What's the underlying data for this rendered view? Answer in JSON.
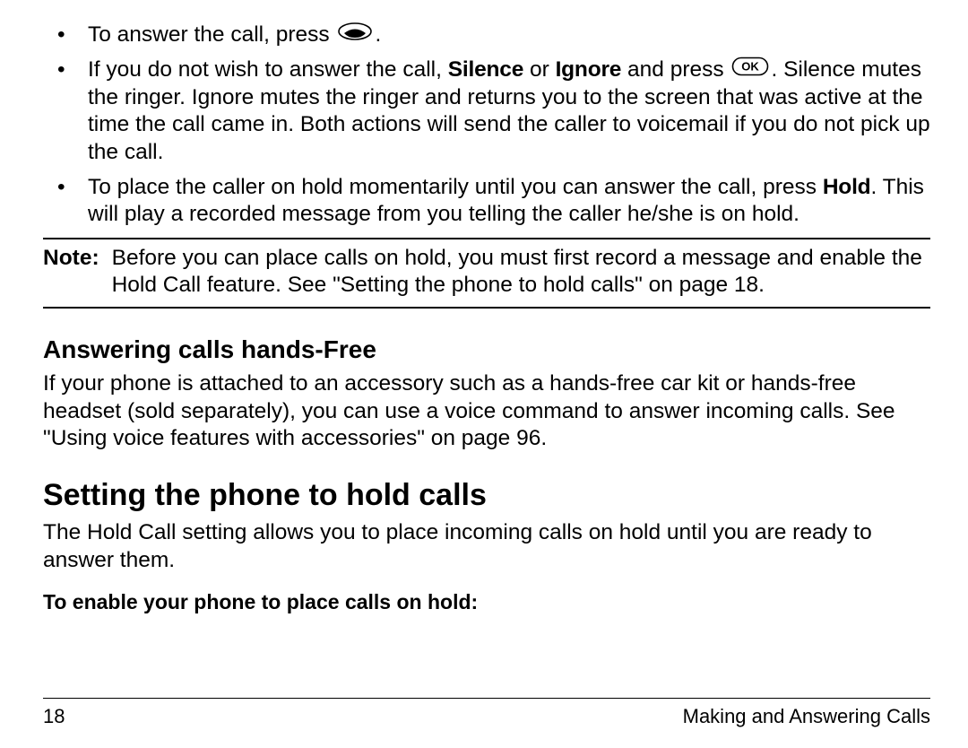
{
  "bullets": {
    "b1_pre": "To answer the call, press ",
    "b1_post": ".",
    "b2_pre": "If you do not wish to answer the call, ",
    "b2_silence": "Silence",
    "b2_or": " or ",
    "b2_ignore": "Ignore",
    "b2_mid": " and press ",
    "b2_post": ". Silence mutes the ringer. Ignore mutes the ringer and returns you to the screen that was active at the time the call came in. Both actions will send the caller to voicemail if you do not pick up the call.",
    "b3_pre": "To place the caller on hold momentarily until you can answer the call, press ",
    "b3_hold": "Hold",
    "b3_post": ". This will play a recorded message from you telling the caller he/she is on hold."
  },
  "note": {
    "label": "Note:",
    "text": "Before you can place calls on hold, you must first record a message and enable the Hold Call feature. See \"Setting the phone to hold calls\" on page 18."
  },
  "handsfree": {
    "heading": "Answering calls hands-Free",
    "text": "If your phone is attached to an accessory such as a hands-free car kit or hands-free headset (sold separately), you can use a voice command to answer incoming calls. See \"Using voice features with accessories\" on page 96."
  },
  "holdcalls": {
    "heading": "Setting the phone to hold calls",
    "text": "The Hold Call setting allows you to place incoming calls on hold until you are ready to answer them.",
    "subhead": "To enable your phone to place calls on hold:"
  },
  "footer": {
    "page": "18",
    "section": "Making and Answering Calls"
  }
}
